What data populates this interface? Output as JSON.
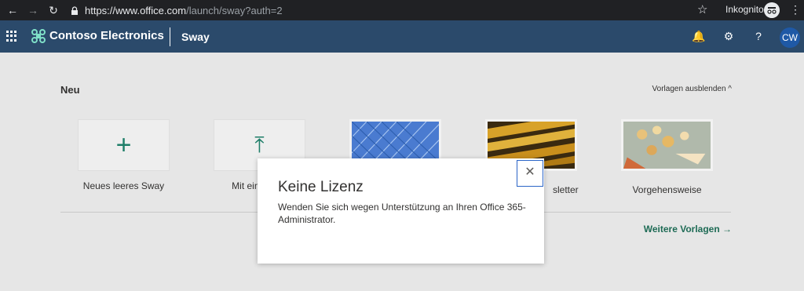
{
  "browser": {
    "back_icon": "←",
    "forward_icon": "→",
    "reload_icon": "↻",
    "url_host": "https://www.office.com",
    "url_path": "/launch/sway?auth=2",
    "bookmark_icon": "☆",
    "incognito_label": "Inkognito",
    "menu_icon": "⋮"
  },
  "suite": {
    "company": "Contoso Electronics",
    "app": "Sway",
    "notification_icon": "🔔",
    "settings_icon": "⚙",
    "help_icon": "?",
    "avatar": "CW"
  },
  "main": {
    "section_title": "Neu",
    "hide_templates": "Vorlagen ausblenden ^",
    "tiles": [
      {
        "label": "Neues leeres Sway",
        "glyph": "+"
      },
      {
        "label": "Mit einem Do",
        "glyph": "⤒"
      },
      {
        "label": ""
      },
      {
        "label": "sletter"
      },
      {
        "label": "Vorgehensweise"
      }
    ],
    "more_templates": "Weitere Vorlagen →"
  },
  "dialog": {
    "title": "Keine Lizenz",
    "message": "Wenden Sie sich wegen Unterstützung an Ihren Office 365-Administrator.",
    "close_glyph": "✕"
  },
  "colors": {
    "suite_bg": "#2b4a6b",
    "accent_green": "#1e7e68",
    "avatar_bg": "#1f59a6"
  }
}
